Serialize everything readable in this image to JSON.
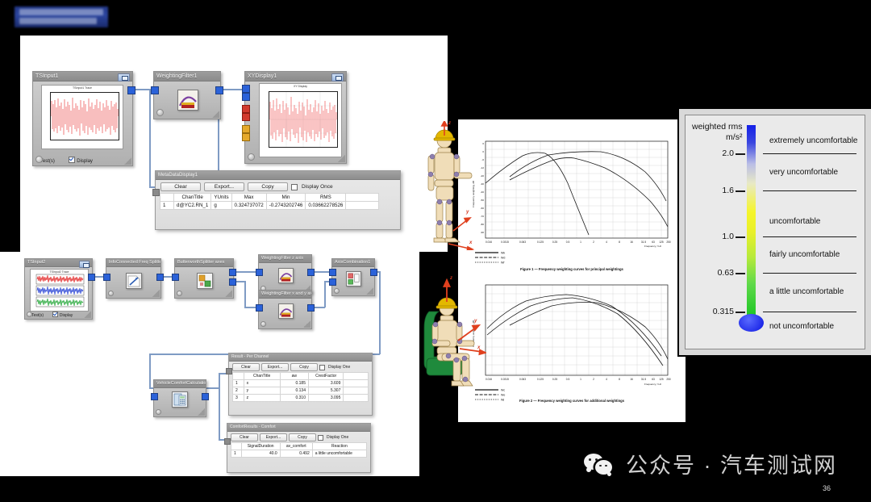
{
  "watermark": {
    "label": "汽车测试网公众号"
  },
  "flow_top": {
    "nodes": [
      {
        "title": "TSInput1",
        "footer_tests": "1 Test(s)",
        "footer_display": "Display"
      },
      {
        "title": "WeightingFilter1"
      },
      {
        "title": "XYDisplay1",
        "plot_title": "XY Display"
      }
    ],
    "metadata_window": {
      "title": "MetaDataDisplay1",
      "buttons": [
        "Clear",
        "Export...",
        "Copy"
      ],
      "display_once_label": "Display Once",
      "columns": [
        "",
        "ChanTitle",
        "YUnits",
        "Max",
        "Min",
        "RMS"
      ],
      "rows": [
        [
          "1",
          "d@YC2.RN_1",
          "g",
          "0.324737072",
          "-0.2743202746",
          "0.03662278526"
        ]
      ]
    }
  },
  "flow_bottom": {
    "nodes": [
      {
        "title": "TSInput2",
        "footer_tests": "1 Test(s)",
        "footer_display": "Display"
      },
      {
        "title": "InfoConnected Freq Splitter"
      },
      {
        "title": "ButterworthSplitter axes"
      },
      {
        "title": "WeightingFilter z axis"
      },
      {
        "title": "WeightingFilter x and y axis"
      },
      {
        "title": "AxisCombination1"
      },
      {
        "title": "VehicleComfortCalculation"
      }
    ],
    "results_window": {
      "title": "Result - Per Channel",
      "buttons": [
        "Clear",
        "Export...",
        "Copy"
      ],
      "display_once_label": "Display One",
      "columns": [
        "",
        "ChanTitle",
        "aw",
        "CrestFactor"
      ],
      "rows": [
        [
          "1",
          "x",
          "0.185",
          "3.609"
        ],
        [
          "2",
          "y",
          "0.134",
          "5.307"
        ],
        [
          "3",
          "z",
          "0.310",
          "3.095"
        ]
      ]
    },
    "comfort_window": {
      "title": "ComfortResults - Comfort",
      "buttons": [
        "Clear",
        "Export...",
        "Copy"
      ],
      "display_once_label": "Display One",
      "columns": [
        "",
        "SignalDuration",
        "av_comfort",
        "Reaction"
      ],
      "rows": [
        [
          "1",
          "40.0",
          "0.492",
          "a little uncomfortable"
        ]
      ]
    }
  },
  "document": {
    "figure1": {
      "caption": "Figure 1 — Frequency weighting curves for principal weightings",
      "ylabel": "Frequency weighting, dB",
      "xlabel": "Frequency, f Hz",
      "xticks": [
        "0.016",
        "0.0315",
        "0.063",
        "0.125",
        "0.25",
        "0.5",
        "1",
        "2",
        "4",
        "8",
        "16",
        "31.5",
        "63",
        "125",
        "250"
      ],
      "yticks": [
        "6",
        "0",
        "-6",
        "-12",
        "-20",
        "-30",
        "-40",
        "-50",
        "-60",
        "-70",
        "-80",
        "-90"
      ],
      "legend": [
        "Wk",
        "Wd",
        "Wf"
      ]
    },
    "figure2": {
      "caption": "Figure 2 — Frequency weighting curves for additional weightings",
      "ylabel": "Frequency weighting, dB",
      "xlabel": "Frequency, f Hz",
      "xticks": [
        "0.016",
        "0.0315",
        "0.063",
        "0.125",
        "0.25",
        "0.5",
        "1",
        "2",
        "4",
        "8",
        "16",
        "31.5",
        "63",
        "125",
        "250"
      ],
      "legend": [
        "Wc",
        "We",
        "Wj"
      ]
    }
  },
  "mannequins": {
    "standing": {
      "axes": [
        "z",
        "y",
        "x"
      ]
    },
    "seated": {
      "axes": [
        "z",
        "y",
        "x"
      ]
    }
  },
  "comfort_scale": {
    "header_line1": "weighted rms",
    "header_line2": "m/s²",
    "ticks": [
      "2.0",
      "1.6",
      "1.0",
      "0.63",
      "0.315"
    ],
    "categories": [
      "extremely uncomfortable",
      "very uncomfortable",
      "uncomfortable",
      "fairly uncomfortable",
      "a little uncomfortable",
      "not uncomfortable"
    ],
    "colors": {
      "top": "#1420e8",
      "mid": "#f5f52a",
      "bottom": "#19c522",
      "bulb": "#0b14e0"
    }
  },
  "footer": {
    "text": "公众号 · 汽车测试网",
    "page_number": "36"
  }
}
